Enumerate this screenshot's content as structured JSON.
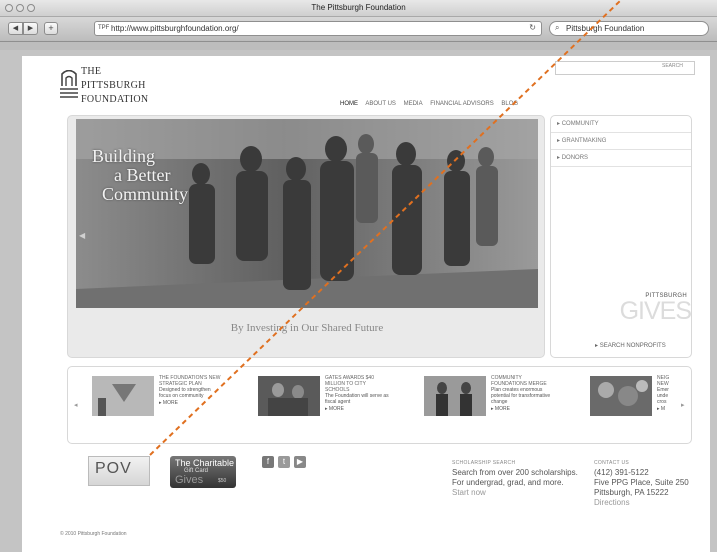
{
  "window": {
    "title": "The Pittsburgh Foundation"
  },
  "toolbar": {
    "back": "◀",
    "forward": "▶",
    "add": "+",
    "url": "http://www.pittsburghfoundation.org/",
    "search_query": "Pittsburgh Foundation"
  },
  "header": {
    "logo_line1": "THE",
    "logo_line2": "PITTSBURGH",
    "logo_line3": "FOUNDATION",
    "search_button": "SEARCH"
  },
  "nav": {
    "items": [
      "HOME",
      "ABOUT US",
      "MEDIA",
      "FINANCIAL ADVISORS",
      "BLOG"
    ]
  },
  "hero": {
    "line1": "Building",
    "line2": "a Better",
    "line3": "Community",
    "caption": "By Investing in Our Shared Future"
  },
  "side": {
    "items": [
      "COMMUNITY",
      "GRANTMAKING",
      "DONORS"
    ],
    "gives_small": "PITTSBURGH",
    "gives_big": "GIVES",
    "search_nonprofits": "SEARCH NONPROFITS"
  },
  "news": {
    "items": [
      {
        "title1": "THE FOUNDATION'S NEW",
        "title2": "STRATEGIC PLAN",
        "body1": "Designed to strengthen",
        "body2": "focus on community",
        "more": "MORE"
      },
      {
        "title1": "GATES AWARDS $40",
        "title2": "MILLION TO CITY",
        "title3": "SCHOOLS",
        "body1": "The Foundation will serve as",
        "body2": "fiscal agent",
        "more": "MORE"
      },
      {
        "title1": "COMMUNITY",
        "title2": "FOUNDATIONS MERGE",
        "body1": "Plan creates enormous",
        "body2": "potential for transformative",
        "body3": "change",
        "more": "MORE"
      },
      {
        "title1": "NEIG",
        "title2": "NEW",
        "body1": "Emer",
        "body2": "unde",
        "body3": "cros",
        "more": "M"
      }
    ]
  },
  "footer": {
    "pov": "POV",
    "gift_line1": "The Charitable",
    "gift_line2": "Gift Card",
    "gift_line3": "Gives",
    "gift_amount": "$50",
    "scholar_heading": "SCHOLARSHIP SEARCH",
    "scholar_line1": "Search from over 200 scholarships.",
    "scholar_line2": "For undergrad, grad, and more.",
    "scholar_link": "Start now",
    "contact_heading": "CONTACT US",
    "contact_phone": "(412) 391-5122",
    "contact_addr1": "Five PPG Place, Suite 250",
    "contact_addr2": "Pittsburgh, PA 15222",
    "contact_link": "Directions",
    "copyright": "© 2010 Pittsburgh Foundation"
  }
}
